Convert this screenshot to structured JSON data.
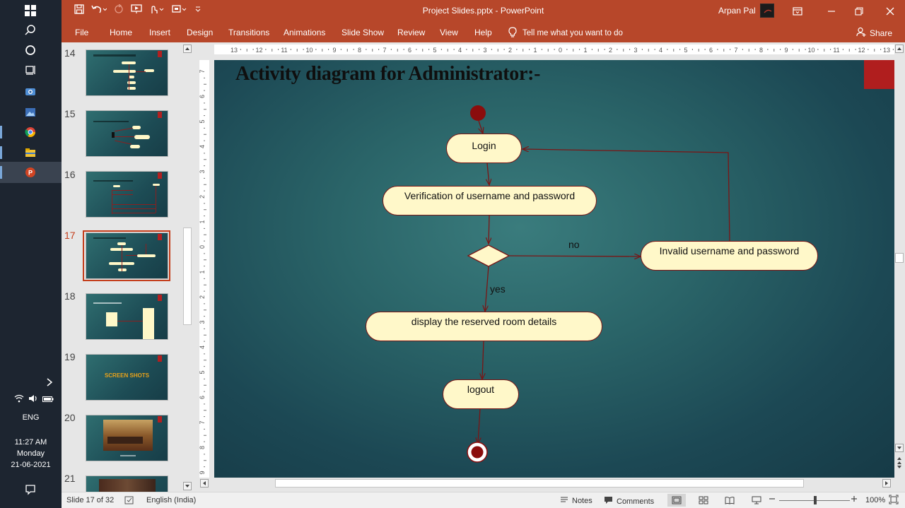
{
  "window": {
    "doc_title": "Project Slides.pptx  -  PowerPoint",
    "user_name": "Arpan Pal"
  },
  "ribbon": {
    "tabs": [
      "File",
      "Home",
      "Insert",
      "Design",
      "Transitions",
      "Animations",
      "Slide Show",
      "Review",
      "View",
      "Help"
    ],
    "tell_me": "Tell me what you want to do",
    "share": "Share"
  },
  "thumbnails": {
    "slides": [
      {
        "number": "14"
      },
      {
        "number": "15"
      },
      {
        "number": "16"
      },
      {
        "number": "17"
      },
      {
        "number": "18"
      },
      {
        "number": "19",
        "text": "SCREEN SHOTS"
      },
      {
        "number": "20"
      },
      {
        "number": "21"
      }
    ]
  },
  "slide": {
    "title": "Activity diagram for Administrator:-",
    "nodes": {
      "login": "Login",
      "verify": "Verification of username and password",
      "invalid": "Invalid username and password",
      "display": "display the reserved room details",
      "logout": "logout"
    },
    "labels": {
      "no": "no",
      "yes": "yes"
    },
    "colors": {
      "accent": "#b01e1e",
      "node_fill": "#fff8c9",
      "edge": "#7a1515"
    }
  },
  "ruler": {
    "h_labels": [
      "13",
      "12",
      "11",
      "10",
      "9",
      "8",
      "7",
      "6",
      "5",
      "4",
      "3",
      "2",
      "1",
      "0",
      "1",
      "2",
      "3",
      "4",
      "5",
      "6",
      "7",
      "8",
      "9",
      "10",
      "11",
      "12",
      "13"
    ],
    "v_labels": [
      "7",
      "6",
      "5",
      "4",
      "3",
      "2",
      "1",
      "0",
      "1",
      "2",
      "3",
      "4",
      "5",
      "6",
      "7",
      "8",
      "9"
    ]
  },
  "status": {
    "slide_info": "Slide 17 of 32",
    "language": "English (India)",
    "notes": "Notes",
    "comments": "Comments",
    "zoom": "100%"
  },
  "taskbar": {
    "language": "ENG",
    "time": "11:27 AM",
    "day": "Monday",
    "date": "21-06-2021"
  }
}
